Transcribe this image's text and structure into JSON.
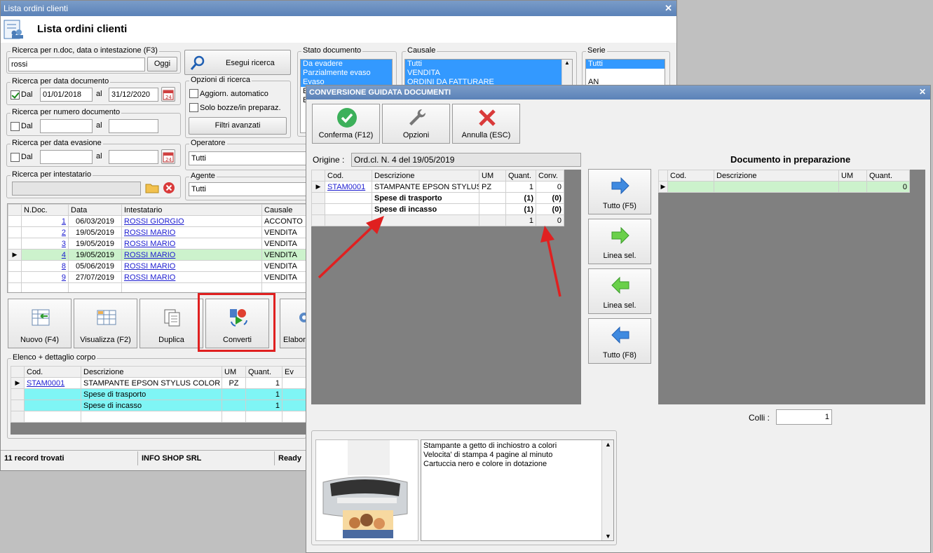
{
  "main": {
    "title": "Lista ordini clienti",
    "header": "Lista ordini clienti",
    "search": {
      "label": "Ricerca per n.doc, data o intestazione (F3)",
      "value": "rossi",
      "oggi": "Oggi",
      "exec": "Esegui ricerca"
    },
    "date_doc": {
      "label": "Ricerca per data documento",
      "dal": "Dal",
      "from": "01/01/2018",
      "al": "al",
      "to": "31/12/2020"
    },
    "num_doc": {
      "label": "Ricerca per numero documento",
      "dal": "Dal",
      "al": "al"
    },
    "date_ev": {
      "label": "Ricerca per data evasione",
      "dal": "Dal",
      "al": "al"
    },
    "intest": {
      "label": "Ricerca per intestatario"
    },
    "options": {
      "label": "Opzioni di ricerca",
      "auto": "Aggiorn. automatico",
      "bozze": "Solo bozze/in preparaz.",
      "filtri": "Filtri avanzati"
    },
    "operatore": {
      "label": "Operatore",
      "value": "Tutti"
    },
    "agente": {
      "label": "Agente",
      "value": "Tutti"
    },
    "stato": {
      "label": "Stato documento",
      "items": [
        "Da evadere",
        "Parzialmente evaso",
        "Evaso",
        "E",
        "E"
      ]
    },
    "causale": {
      "label": "Causale",
      "items": [
        "Tutti",
        "VENDITA",
        "ORDINI DA FATTURARE"
      ]
    },
    "serie": {
      "label": "Serie",
      "items": [
        "Tutti",
        "",
        "AN"
      ]
    },
    "orders": {
      "headers": [
        "N.Doc.",
        "Data",
        "Intestatario",
        "Causale"
      ],
      "rows": [
        [
          "1",
          "06/03/2019",
          "ROSSI GIORGIO",
          "ACCONTO"
        ],
        [
          "2",
          "19/05/2019",
          "ROSSI MARIO",
          "VENDITA"
        ],
        [
          "3",
          "19/05/2019",
          "ROSSI MARIO",
          "VENDITA"
        ],
        [
          "4",
          "19/05/2019",
          "ROSSI MARIO",
          "VENDITA"
        ],
        [
          "8",
          "05/06/2019",
          "ROSSI MARIO",
          "VENDITA"
        ],
        [
          "9",
          "27/07/2019",
          "ROSSI MARIO",
          "VENDITA"
        ]
      ]
    },
    "toolbar": {
      "nuovo": "Nuovo (F4)",
      "visualizza": "Visualizza (F2)",
      "duplica": "Duplica",
      "converti": "Converti",
      "elabora": "Elabora"
    },
    "detail": {
      "label": "Elenco + dettaglio corpo",
      "headers": [
        "Cod.",
        "Descrizione",
        "UM",
        "Quant.",
        "Ev"
      ],
      "rows": [
        [
          "STAM0001",
          "STAMPANTE EPSON STYLUS COLOR C...",
          "PZ",
          "1"
        ],
        [
          "",
          "Spese di trasporto",
          "",
          "1"
        ],
        [
          "",
          "Spese di incasso",
          "",
          "1"
        ]
      ]
    },
    "status": {
      "records": "11 record trovati",
      "company": "INFO SHOP SRL",
      "state": "Ready"
    }
  },
  "conv": {
    "title": "CONVERSIONE GUIDATA DOCUMENTI",
    "conferma": "Conferma (F12)",
    "opzioni": "Opzioni",
    "annulla": "Annulla (ESC)",
    "origine_label": "Origine :",
    "origine_value": "Ord.cl. N. 4 del 19/05/2019",
    "left": {
      "headers": [
        "Cod.",
        "Descrizione",
        "UM",
        "Quant.",
        "Conv."
      ],
      "rows": [
        [
          "STAM0001",
          "STAMPANTE EPSON STYLUS...",
          "PZ",
          "1",
          "0"
        ],
        [
          "",
          "Spese di trasporto",
          "",
          "(1)",
          "(0)"
        ],
        [
          "",
          "Spese di incasso",
          "",
          "(1)",
          "(0)"
        ],
        [
          "",
          "",
          "",
          "1",
          "0"
        ]
      ]
    },
    "right": {
      "title": "Documento in preparazione",
      "headers": [
        "Cod.",
        "Descrizione",
        "UM",
        "Quant."
      ],
      "rows": [
        [
          "",
          "",
          "",
          "0"
        ]
      ]
    },
    "buttons": {
      "tutto_f5": "Tutto (F5)",
      "linea_sel": "Linea sel.",
      "linea_sel2": "Linea sel.",
      "tutto_f8": "Tutto (F8)"
    },
    "colli_label": "Colli :",
    "colli_value": "1",
    "description": [
      "Stampante a getto di inchiostro a colori",
      "Velocita' di stampa 4 pagine al minuto",
      "Cartuccia nero e colore in dotazione"
    ]
  },
  "colors": {
    "accent_red": "#e02020",
    "selection": "#3399ff",
    "row_green": "#ccf2cc",
    "row_cyan": "#7ff5f5"
  }
}
